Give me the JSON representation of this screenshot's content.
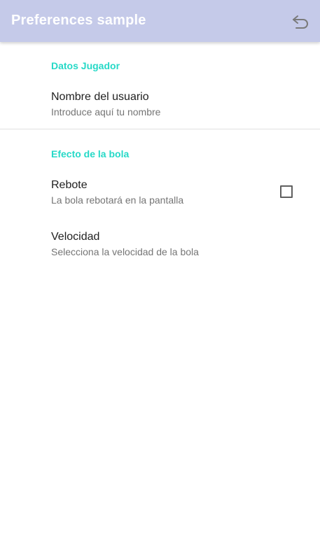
{
  "app_bar": {
    "title": "Preferences sample",
    "back_icon": "undo-arrow-icon",
    "background": "#c5cae9"
  },
  "categories": [
    {
      "title": "Datos Jugador",
      "preferences": [
        {
          "title": "Nombre del usuario",
          "summary": "Introduce aquí tu nombre"
        }
      ]
    },
    {
      "title": "Efecto de la bola",
      "preferences": [
        {
          "title": "Rebote",
          "summary": "La bola rebotará en la pantalla",
          "checked": false
        },
        {
          "title": "Velocidad",
          "summary": "Selecciona la velocidad de la bola"
        }
      ]
    }
  ],
  "colors": {
    "category_accent": "#26d9c7",
    "title_text": "#212121",
    "summary_text": "#757575"
  }
}
